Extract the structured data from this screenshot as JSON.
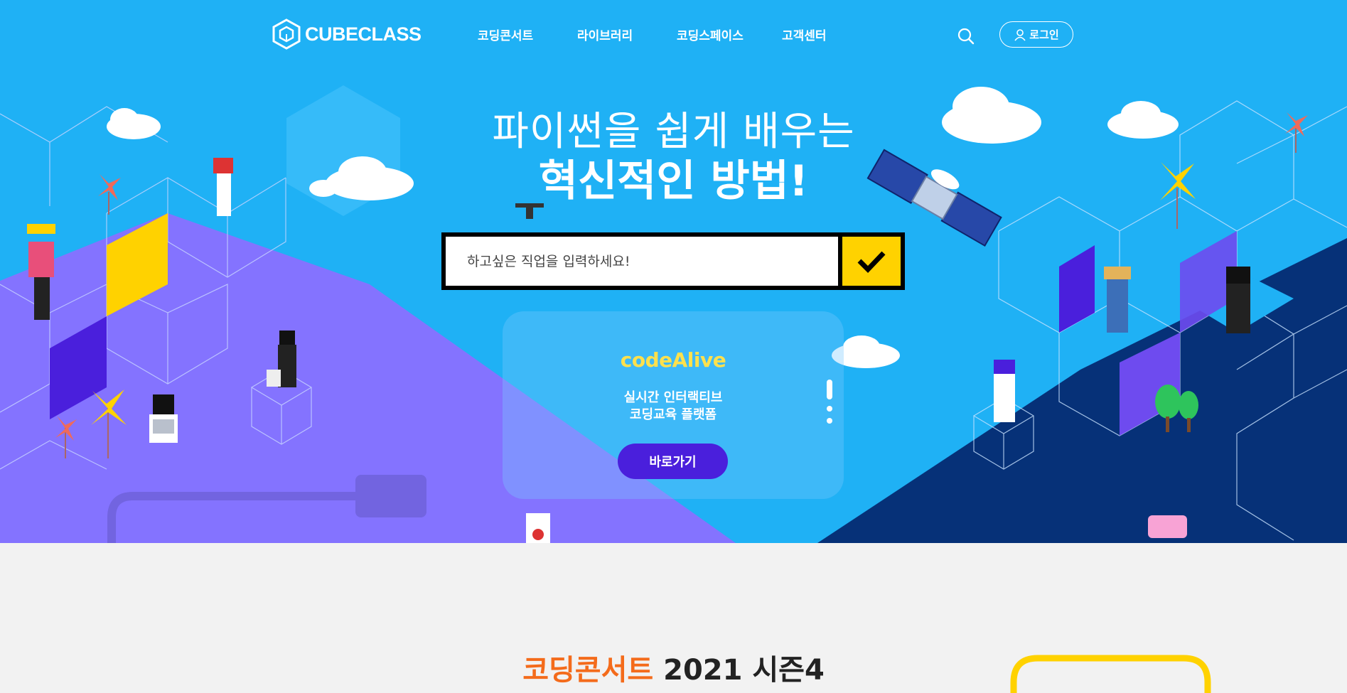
{
  "header": {
    "logo_text": "CUBECLASS",
    "nav": [
      "코딩콘서트",
      "라이브러리",
      "코딩스페이스",
      "고객센터"
    ],
    "login_label": "로그인"
  },
  "hero": {
    "subtitle": "파이썬을 쉽게 배우는",
    "title": "혁신적인 방법!",
    "search_placeholder": "하고싶은 직업을 입력하세요!"
  },
  "promo": {
    "brand": "codeAlive",
    "desc_line1": "실시간 인터랙티브",
    "desc_line2": "코딩교육 플랫폼",
    "button_label": "바로가기"
  },
  "concert": {
    "title_accent": "코딩콘서트",
    "title_rest": "2021 시즌4"
  },
  "colors": {
    "sky": "#1fb1f5",
    "purple": "#8473ff",
    "navy": "#063178",
    "yellow": "#ffd200",
    "button_purple": "#4a1fdc",
    "concert_orange": "#f46b1b"
  },
  "icons": [
    "cube-logo-icon",
    "search-icon",
    "user-icon",
    "check-icon"
  ]
}
